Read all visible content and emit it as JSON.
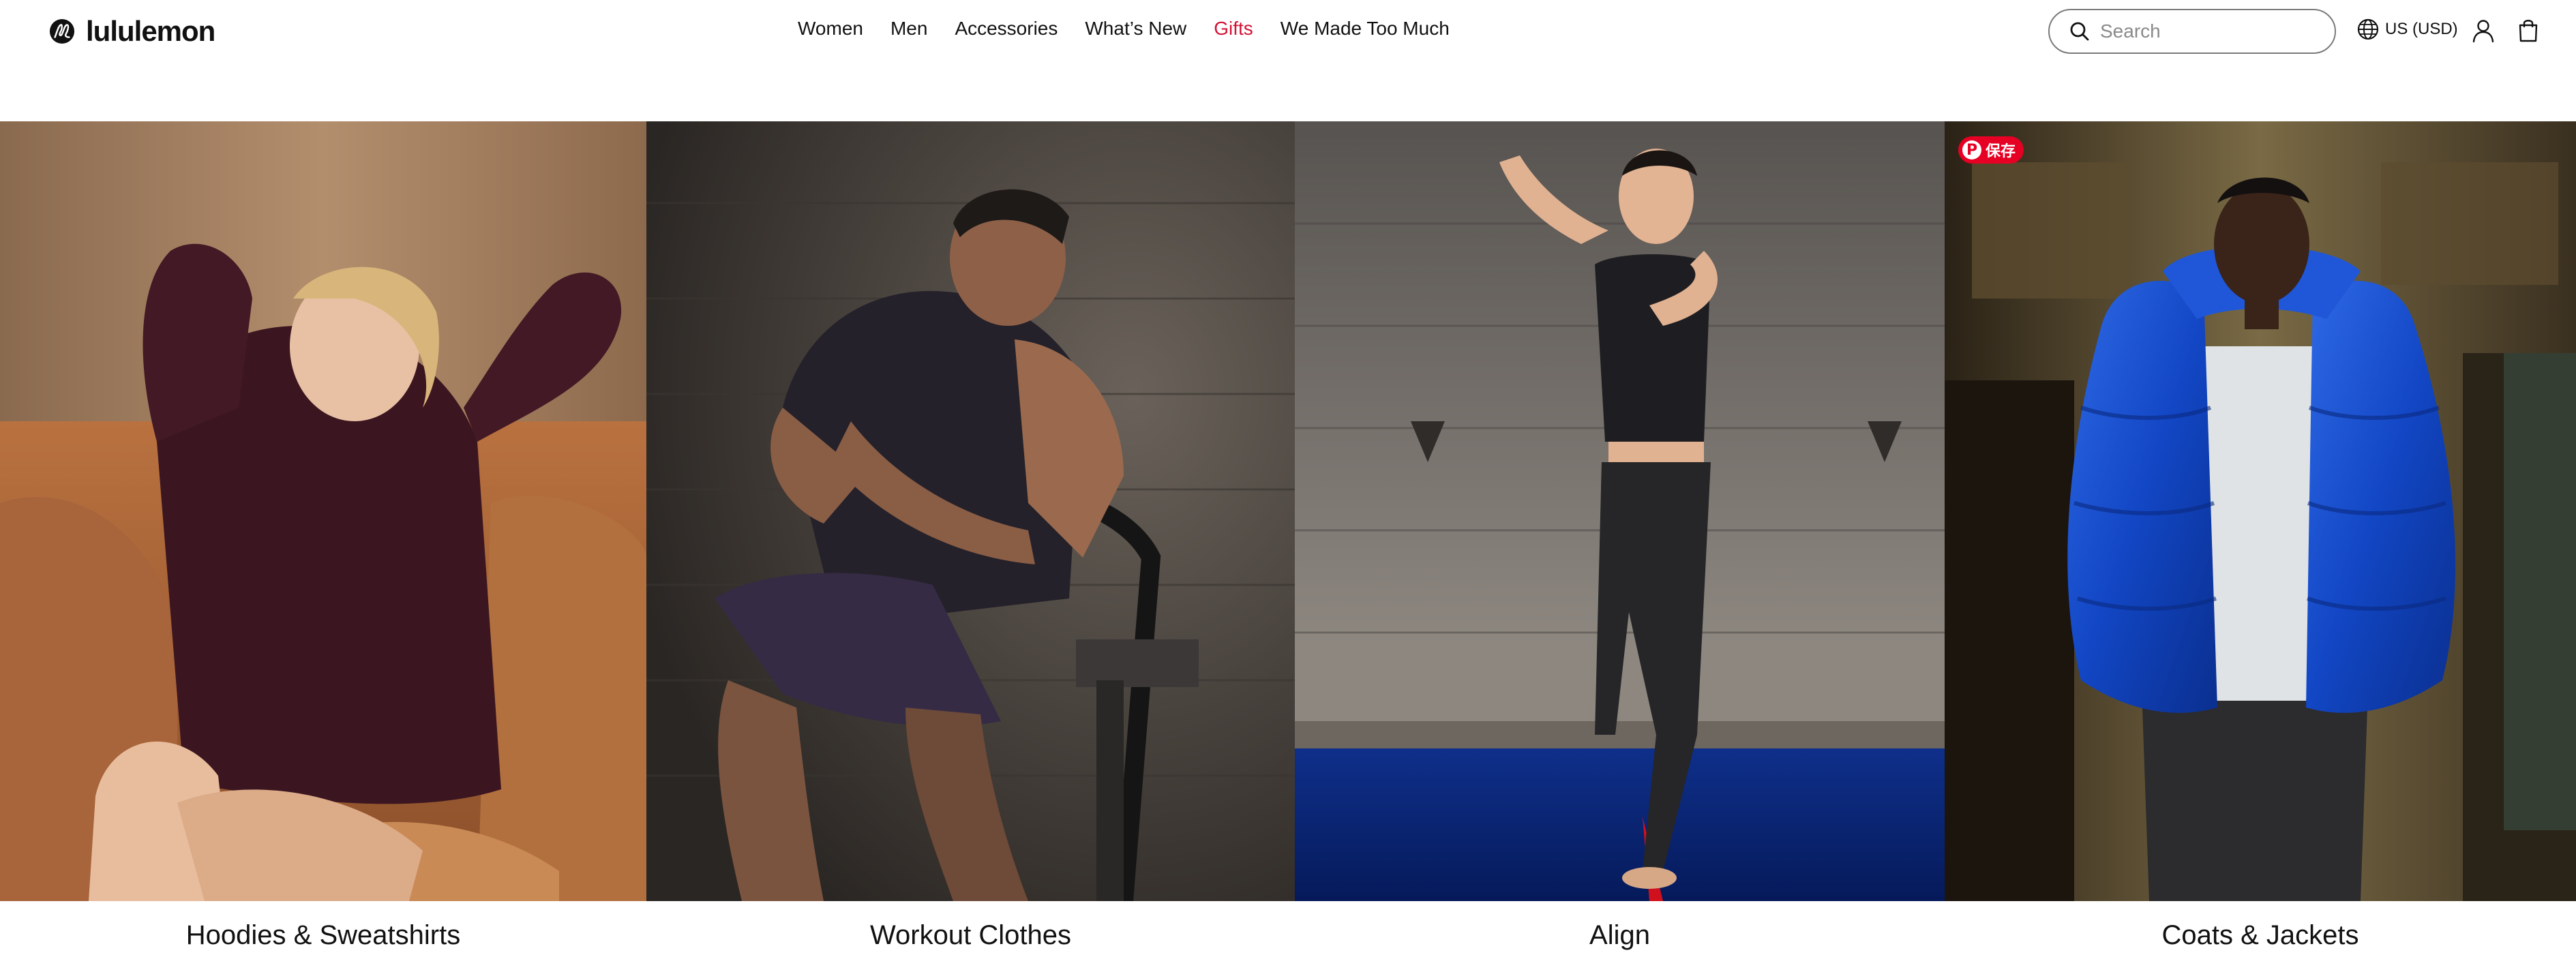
{
  "header": {
    "brand": "lululemon",
    "nav": [
      {
        "label": "Women"
      },
      {
        "label": "Men"
      },
      {
        "label": "Accessories"
      },
      {
        "label": "What’s New"
      },
      {
        "label": "Gifts"
      },
      {
        "label": "We Made Too Much"
      }
    ],
    "search": {
      "placeholder": "Search",
      "value": ""
    },
    "locale": "US (USD)",
    "icons": {
      "logo": "lululemon-logo-icon",
      "search": "search-icon",
      "locale": "globe-icon",
      "account": "user-icon",
      "bag": "shopping-bag-icon"
    },
    "accent_color": "#d31334"
  },
  "tiles": [
    {
      "label": "Hoodies & Sweatshirts"
    },
    {
      "label": "Workout Clothes"
    },
    {
      "label": "Align"
    },
    {
      "label": "Coats & Jackets",
      "pin_save_label": "保存"
    }
  ]
}
